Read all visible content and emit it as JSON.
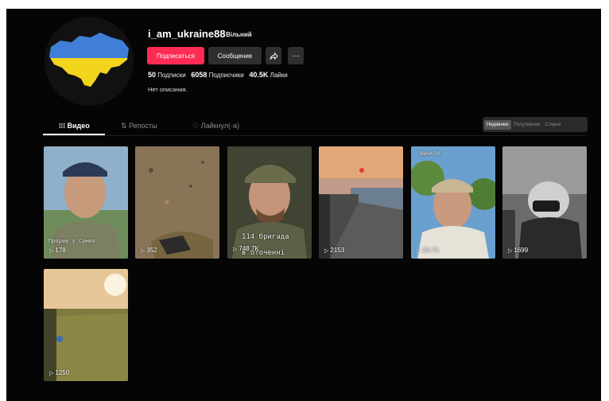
{
  "profile": {
    "username": "i_am_ukraine88",
    "tag": "Вільний",
    "follow_label": "Подписаться",
    "message_label": "Сообщение",
    "share_icon": "share-icon",
    "more_label": "···",
    "following_count": "50",
    "following_label": "Подписки",
    "followers_count": "6058",
    "followers_label": "Подписчики",
    "likes_count": "40.5K",
    "likes_label": "Лайки",
    "bio": "Нет описания."
  },
  "tabs": {
    "videos": "Видео",
    "reposts": "Репосты",
    "liked": "Лайкнул(-а)"
  },
  "sort": {
    "newest": "Недавнее",
    "popular": "Популярное",
    "oldest": "Старое"
  },
  "videos": [
    {
      "views": "178",
      "caption": "Прорив у Сумах"
    },
    {
      "views": "352",
      "caption": ""
    },
    {
      "views": "748.7K",
      "caption": "114 бригада",
      "caption2": "в оточенні"
    },
    {
      "views": "2153",
      "caption": ""
    },
    {
      "views": "30.7K",
      "caption": "занили"
    },
    {
      "views": "1699",
      "caption": ""
    },
    {
      "views": "1250",
      "caption": ""
    }
  ],
  "colors": {
    "accent": "#fe2c55",
    "background": "#050505",
    "flag_blue": "#3f7fd8",
    "flag_yellow": "#f3d41c"
  }
}
